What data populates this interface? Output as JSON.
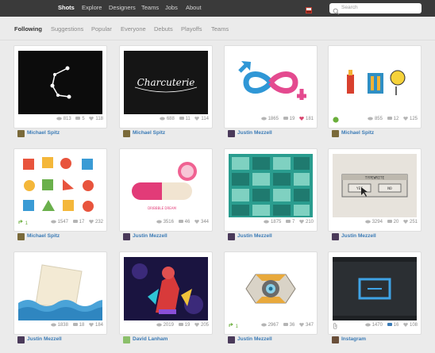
{
  "nav": {
    "logo": "Shots",
    "items": [
      "Explore",
      "Designers",
      "Teams",
      "Jobs",
      "About"
    ]
  },
  "search": {
    "placeholder": "Search"
  },
  "subnav": {
    "items": [
      "Following",
      "Suggestions",
      "Popular",
      "Everyone",
      "Debuts",
      "Playoffs",
      "Teams"
    ]
  },
  "colors": {
    "topbar": "#3a3a3a",
    "link": "#3b7bb6",
    "like": "#d9466f",
    "rebound": "#6aae3b"
  },
  "shots": [
    {
      "author": "Michael Spitz",
      "views": "813",
      "comments": "5",
      "likes": "118",
      "rebound": "",
      "art": "constellation-c"
    },
    {
      "author": "Michael Spitz",
      "views": "688",
      "comments": "11",
      "likes": "114",
      "rebound": "",
      "art": "charcuterie-lettering",
      "text": "Charcuterie"
    },
    {
      "author": "Justin Mezzell",
      "views": "1865",
      "comments": "19",
      "likes": "181",
      "rebound": "",
      "art": "gender-infinity",
      "liked": true
    },
    {
      "author": "Michael Spitz",
      "views": "855",
      "comments": "12",
      "likes": "125",
      "rebound": "",
      "art": "food-illustrations"
    },
    {
      "author": "Michael Spitz",
      "views": "1547",
      "comments": "17",
      "likes": "232",
      "rebound": "1",
      "art": "icon-grid"
    },
    {
      "author": "Justin Mezzell",
      "views": "3516",
      "comments": "46",
      "likes": "344",
      "rebound": "",
      "art": "pill-capsule",
      "text": "DRIBBBLE DREAM"
    },
    {
      "author": "Justin Mezzell",
      "views": "1875",
      "comments": "7",
      "likes": "210",
      "rebound": "",
      "art": "teal-icon-set"
    },
    {
      "author": "Justin Mezzell",
      "views": "3294",
      "comments": "20",
      "likes": "251",
      "rebound": "",
      "art": "retro-dialog",
      "text": {
        "title": "TYPEWRITE",
        "yes": "YES",
        "no": "NO"
      }
    },
    {
      "author": "Justin Mezzell",
      "views": "1838",
      "comments": "18",
      "likes": "184",
      "rebound": "",
      "art": "paper-waves"
    },
    {
      "author": "David Lanham",
      "views": "2019",
      "comments": "19",
      "likes": "205",
      "rebound": "",
      "art": "neon-character"
    },
    {
      "author": "Justin Mezzell",
      "views": "2967",
      "comments": "36",
      "likes": "347",
      "rebound": "1",
      "art": "companion-cube"
    },
    {
      "author": "Instagram",
      "views": "1470",
      "comments": "16",
      "likes": "108",
      "rebound": "",
      "art": "camera-frame",
      "attachment": true
    }
  ]
}
